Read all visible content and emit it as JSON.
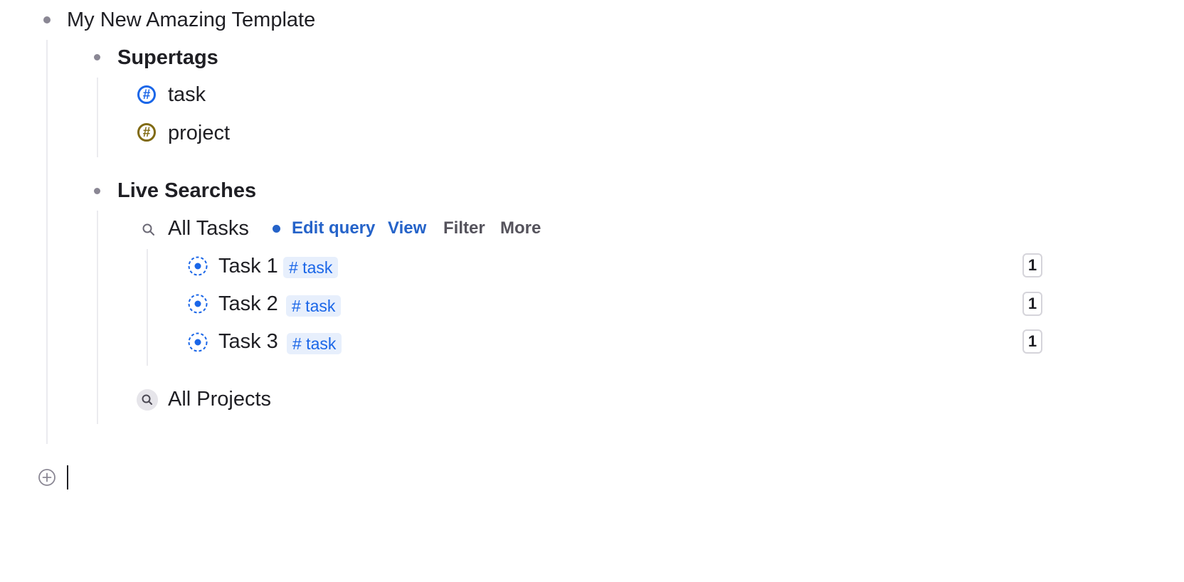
{
  "root": {
    "title": "My New Amazing Template"
  },
  "supertags": {
    "heading": "Supertags",
    "items": [
      {
        "label": "task",
        "icon": "hash-icon",
        "color": "#1a66e8"
      },
      {
        "label": "project",
        "icon": "hash-icon",
        "color": "#806a12"
      }
    ]
  },
  "live_searches": {
    "heading": "Live Searches",
    "all_tasks": {
      "title": "All Tasks",
      "actions": {
        "edit_query": "Edit query",
        "view": "View",
        "filter": "Filter",
        "more": "More"
      },
      "tasks": [
        {
          "title": "Task 1",
          "tag": "# task",
          "count": "1"
        },
        {
          "title": "Task 2",
          "tag": "# task",
          "count": "1"
        },
        {
          "title": "Task 3",
          "tag": "# task",
          "count": "1"
        }
      ]
    },
    "all_projects": {
      "title": "All Projects"
    }
  },
  "colors": {
    "accent": "#1a66e8",
    "project_tag": "#806a12",
    "action_blue": "#2563c9",
    "action_gray": "#55535c"
  }
}
